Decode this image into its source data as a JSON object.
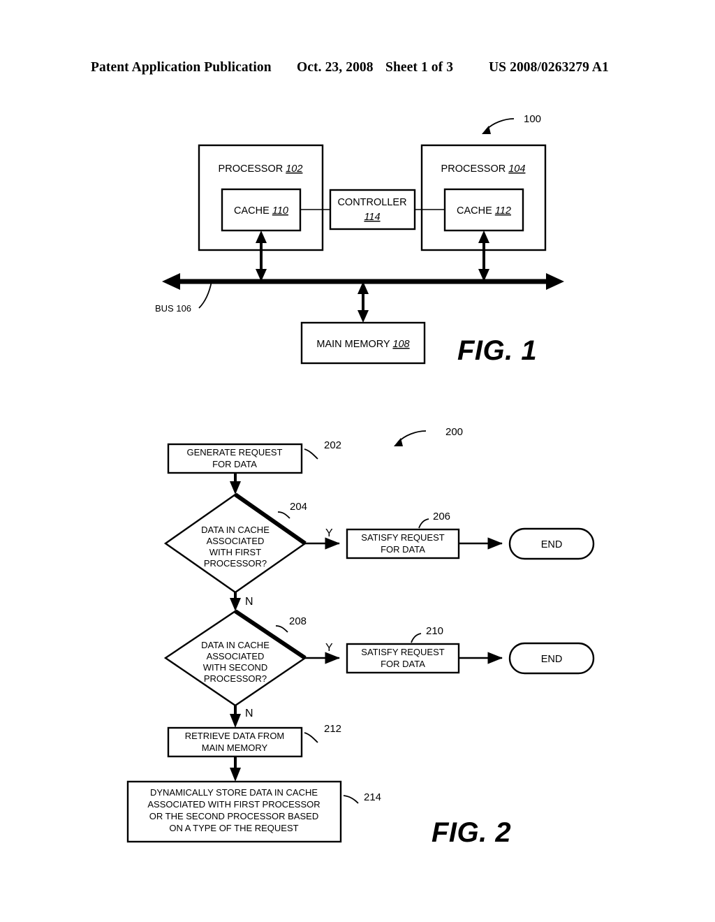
{
  "header": {
    "publication": "Patent Application Publication",
    "date": "Oct. 23, 2008",
    "sheet": "Sheet 1 of 3",
    "patent_number": "US 2008/0263279 A1"
  },
  "figure1": {
    "label": "FIG. 1",
    "callout": "100",
    "processor_left": {
      "text": "PROCESSOR ",
      "ref": "102"
    },
    "processor_right": {
      "text": "PROCESSOR ",
      "ref": "104"
    },
    "cache_left": {
      "text": "CACHE ",
      "ref": "110"
    },
    "cache_right": {
      "text": "CACHE ",
      "ref": "112"
    },
    "controller": {
      "text": "CONTROLLER",
      "ref": "114"
    },
    "bus": "BUS 106",
    "main_memory": {
      "text": "MAIN MEMORY ",
      "ref": "108"
    }
  },
  "figure2": {
    "label": "FIG. 2",
    "callout": "200",
    "steps": [
      {
        "ref": "202",
        "line1": "GENERATE REQUEST",
        "line2": "FOR DATA"
      },
      {
        "ref": "204",
        "line1": "DATA IN CACHE",
        "line2": "ASSOCIATED",
        "line3": "WITH FIRST",
        "line4": "PROCESSOR?"
      },
      {
        "ref": "206",
        "line1": "SATISFY REQUEST",
        "line2": "FOR DATA"
      },
      {
        "ref": "208",
        "line1": "DATA IN CACHE",
        "line2": "ASSOCIATED",
        "line3": "WITH SECOND",
        "line4": "PROCESSOR?"
      },
      {
        "ref": "210",
        "line1": "SATISFY REQUEST",
        "line2": "FOR DATA"
      },
      {
        "ref": "212",
        "line1": "RETRIEVE DATA FROM",
        "line2": "MAIN MEMORY"
      },
      {
        "ref": "214",
        "line1": "DYNAMICALLY STORE DATA IN CACHE",
        "line2": "ASSOCIATED WITH FIRST PROCESSOR",
        "line3": "OR THE SECOND PROCESSOR BASED",
        "line4": "ON A TYPE OF THE REQUEST"
      }
    ],
    "terminal_end_1": "END",
    "terminal_end_2": "END",
    "branch_yes_1": "Y",
    "branch_no_1": "N",
    "branch_yes_2": "Y",
    "branch_no_2": "N"
  },
  "colors": {
    "ink": "#000000",
    "paper": "#ffffff"
  }
}
